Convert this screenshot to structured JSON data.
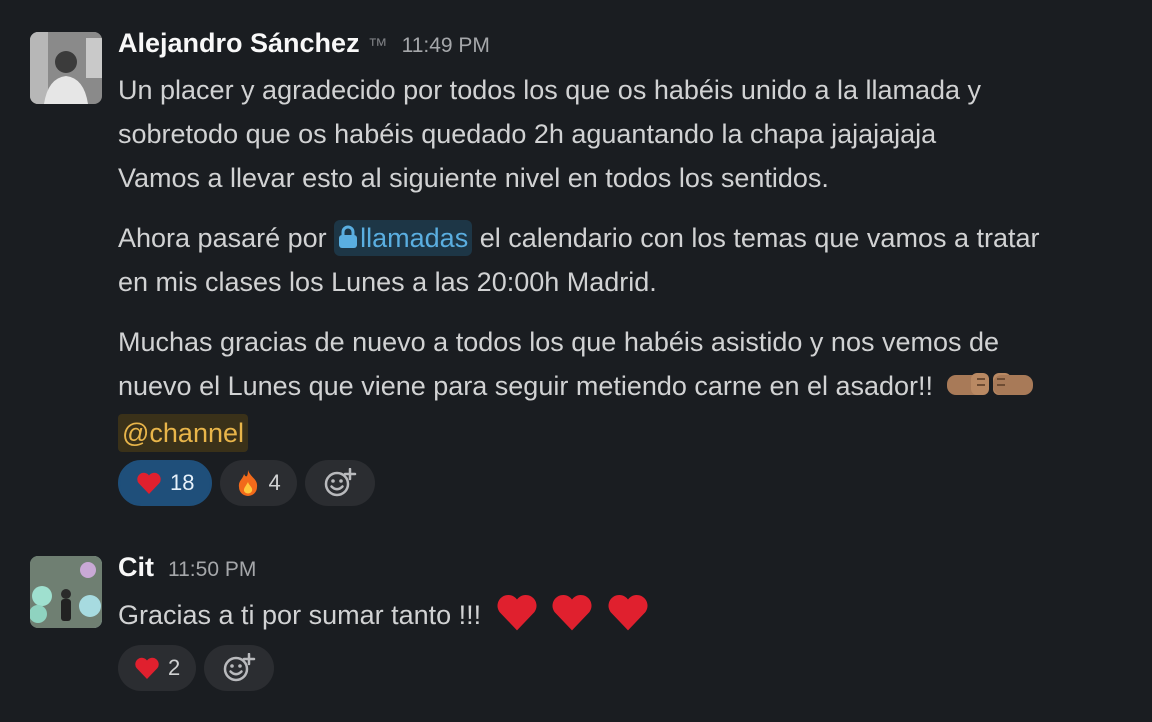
{
  "messages": [
    {
      "author": "Alejandro Sánchez",
      "status": "™",
      "time": "11:49 PM",
      "lines": [
        "Un placer y agradecido por todos los que os habéis unido a la llamada y",
        "sobretodo que os habéis quedado 2h aguantando la chapa jajajajaja",
        "Vamos a llevar esto al siguiente nivel en todos los sentidos."
      ],
      "para2_prefix": "Ahora pasaré por ",
      "para2_channel": "llamadas",
      "para2_suffix": " el calendario con los temas que vamos a tratar",
      "para2_line2": "en mis clases los Lunes a las 20:00h Madrid.",
      "para3_line1": "Muchas gracias de nuevo a todos los que habéis asistido y nos vemos de",
      "para3_line2": "nuevo el Lunes que viene para seguir metiendo carne en el asador!!",
      "mention": "@channel",
      "reactions": [
        {
          "emoji": "❤️",
          "count": "18",
          "active": true
        },
        {
          "emoji": "🔥",
          "count": "4",
          "active": false
        }
      ]
    },
    {
      "author": "Cit",
      "time": "11:50 PM",
      "text": "Gracias a ti por sumar tanto !!!",
      "reactions": [
        {
          "emoji": "❤️",
          "count": "2",
          "active": false
        }
      ]
    }
  ]
}
